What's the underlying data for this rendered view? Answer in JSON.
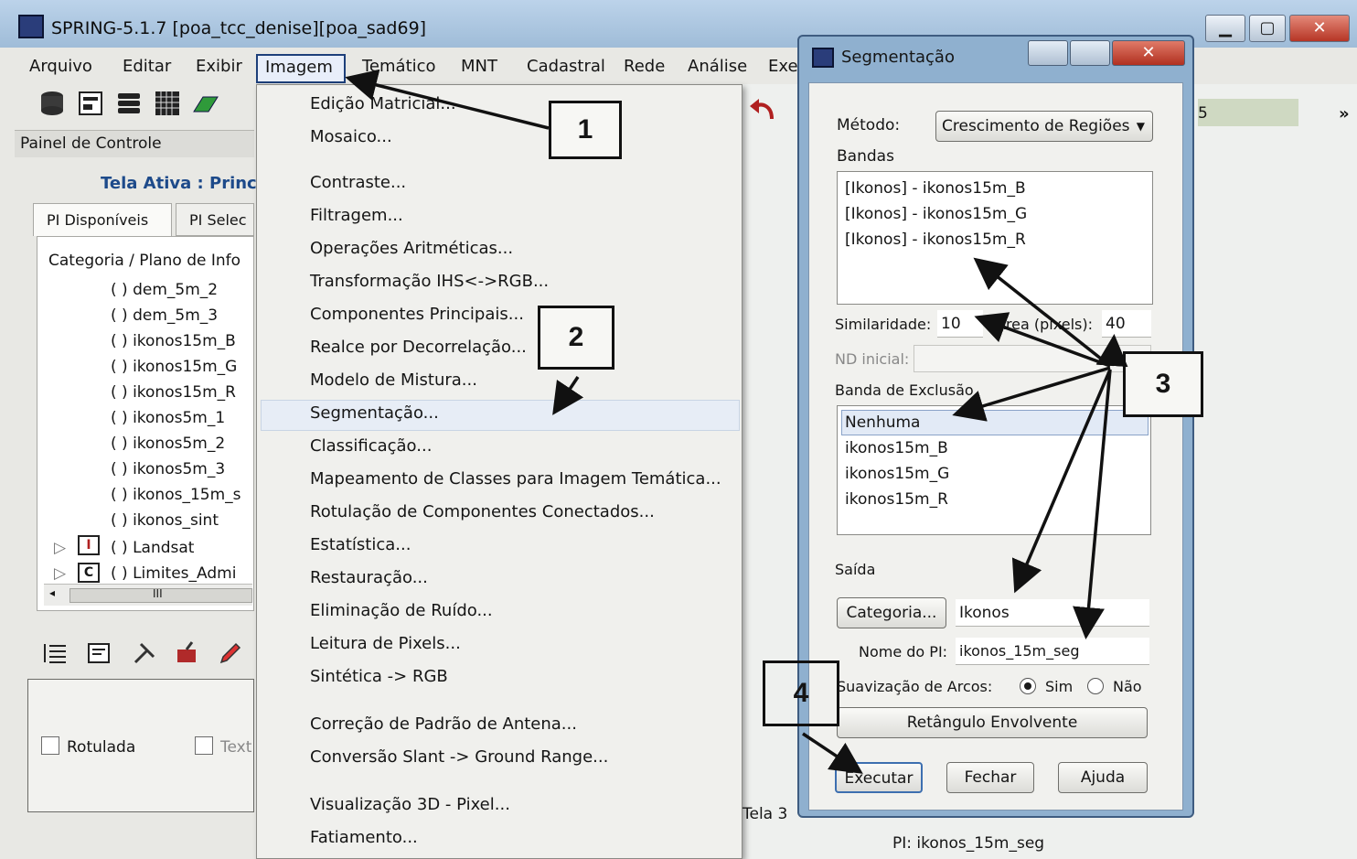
{
  "main_window": {
    "title": "SPRING-5.1.7 [poa_tcc_denise][poa_sad69]",
    "controls": {
      "minimize": "▁",
      "maximize": "▢",
      "close": "✕"
    }
  },
  "menubar": {
    "items": [
      "Arquivo",
      "Editar",
      "Exibir",
      "Imagem",
      "Temático",
      "MNT",
      "Cadastral",
      "Rede",
      "Análise",
      "Exe"
    ]
  },
  "control_panel": {
    "title": "Painel de Controle",
    "active_screen": "Tela Ativa : Princ",
    "tabs": [
      "PI Disponíveis",
      "PI Selec"
    ],
    "tree_header": "Categoria / Plano de Info",
    "tree_items": [
      "( ) dem_5m_2",
      "( ) dem_5m_3",
      "( ) ikonos15m_B",
      "( ) ikonos15m_G",
      "( ) ikonos15m_R",
      "( ) ikonos5m_1",
      "( ) ikonos5m_2",
      "( ) ikonos5m_3",
      "( ) ikonos_15m_s",
      "( ) ikonos_sint"
    ],
    "categories": [
      {
        "badge": "I",
        "label": "( ) Landsat"
      },
      {
        "badge": "C",
        "label": "( ) Limites_Admi"
      }
    ],
    "scroll_glyph": "III",
    "options": {
      "rotulada": "Rotulada",
      "texto": "Text"
    }
  },
  "imagem_menu": {
    "items": [
      "Edição Matricial...",
      "Mosaico...",
      "Contraste...",
      "Filtragem...",
      "Operações Aritméticas...",
      "Transformação IHS<->RGB...",
      "Componentes Principais...",
      "Realce por Decorrelação...",
      "Modelo de Mistura...",
      "Segmentação...",
      "Classificação...",
      "Mapeamento de Classes para Imagem Temática...",
      "Rotulação de Componentes Conectados...",
      "Estatística...",
      "Restauração...",
      "Eliminação de Ruído...",
      "Leitura de Pixels...",
      "Sintética -> RGB",
      "Correção de Padrão de Antena...",
      "Conversão Slant -> Ground Range...",
      "Visualização 3D - Pixel...",
      "Fatiamento..."
    ],
    "highlighted": "Segmentação..."
  },
  "segmentacao_dialog": {
    "title": "Segmentação",
    "metodo_label": "Método:",
    "metodo_value": "Crescimento de Regiões",
    "bandas_label": "Bandas",
    "bandas": [
      "[Ikonos] - ikonos15m_B",
      "[Ikonos] - ikonos15m_G",
      "[Ikonos] - ikonos15m_R"
    ],
    "similaridade_label": "Similaridade:",
    "similaridade_value": "10",
    "area_label": "Área (pixels):",
    "area_value": "40",
    "nd_inicial_label": "ND inicial:",
    "exclusao_label": "Banda de Exclusão",
    "exclusao_items": [
      "Nenhuma",
      "ikonos15m_B",
      "ikonos15m_G",
      "ikonos15m_R"
    ],
    "exclusao_selected": "Nenhuma",
    "saida_label": "Saída",
    "categoria_button": "Categoria...",
    "categoria_value": "Ikonos",
    "nome_pi_label": "Nome do PI:",
    "nome_pi_value": "ikonos_15m_seg",
    "suavizacao_label": "Suavização de Arcos:",
    "radio_sim": "Sim",
    "radio_nao": "Não",
    "retangulo_button": "Retângulo Envolvente",
    "executar_button": "Executar",
    "fechar_button": "Fechar",
    "ajuda_button": "Ajuda"
  },
  "callouts": [
    "1",
    "2",
    "3",
    "4"
  ],
  "status": {
    "tela": "Tela 3",
    "pi": "PI: ikonos_15m_seg",
    "right_strip": "5",
    "chevrons": "»"
  },
  "colors": {
    "title_active": "#1d4a8a",
    "dialog_frame": "#8fb0cf",
    "close_red": "#b63525"
  }
}
